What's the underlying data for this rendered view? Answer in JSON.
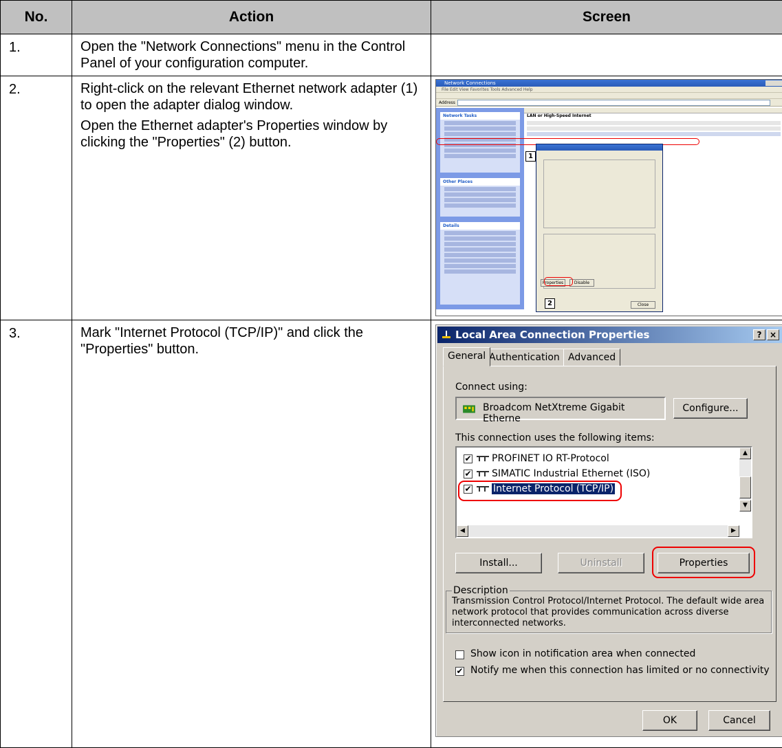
{
  "table": {
    "headers": {
      "no": "No.",
      "action": "Action",
      "screen": "Screen"
    }
  },
  "rows": [
    {
      "no": "1.",
      "action": [
        "Open the \"Network Connections\" menu in the Control Panel of your configuration computer."
      ]
    },
    {
      "no": "2.",
      "action": [
        "Right-click on the relevant Ethernet network adapter (1) to open the adapter dialog window.",
        "Open the Ethernet adapter's Properties window by clicking the \"Properties\" (2) button."
      ]
    },
    {
      "no": "3.",
      "action": [
        "Mark \"Internet Protocol (TCP/IP)\" and click the \"Properties\" button."
      ]
    }
  ],
  "screenshot_small": {
    "window_title": "Network Connections",
    "menu": "File   Edit   View   Favorites   Tools   Advanced   Help",
    "address_label": "Address",
    "address_value": "Network Connections",
    "group_header": "LAN or High-Speed Internet",
    "pane_tasks": "Network Tasks",
    "pane_places": "Other Places",
    "pane_details": "Details",
    "status_dialog_title": "Local Area Connection Status",
    "marker1": "1",
    "marker2": "2",
    "btn_properties": "Properties",
    "btn_disable": "Disable",
    "btn_close": "Close"
  },
  "dialog": {
    "title": "Local Area Connection Properties",
    "tabs": [
      "General",
      "Authentication",
      "Advanced"
    ],
    "connect_using_label": "Connect using:",
    "adapter_name": "Broadcom NetXtreme Gigabit Etherne",
    "configure_button": "Configure...",
    "items_label": "This connection uses the following items:",
    "items": [
      {
        "label": "PROFINET IO RT-Protocol",
        "checked": true
      },
      {
        "label": "SIMATIC Industrial Ethernet (ISO)",
        "checked": true
      },
      {
        "label": "Internet Protocol (TCP/IP)",
        "checked": true,
        "selected": true
      }
    ],
    "install_button": "Install...",
    "uninstall_button": "Uninstall",
    "properties_button": "Properties",
    "description_legend": "Description",
    "description_text": "Transmission Control Protocol/Internet Protocol. The default wide area network protocol that provides communication across diverse interconnected networks.",
    "show_icon_label": "Show icon in notification area when connected",
    "notify_label": "Notify me when this connection has limited or no connectivity",
    "show_icon_checked": false,
    "notify_checked": true,
    "ok_button": "OK",
    "cancel_button": "Cancel",
    "help_glyph": "?",
    "close_glyph": "×",
    "check_glyph": "✔",
    "accent_highlight": "#e00000"
  }
}
